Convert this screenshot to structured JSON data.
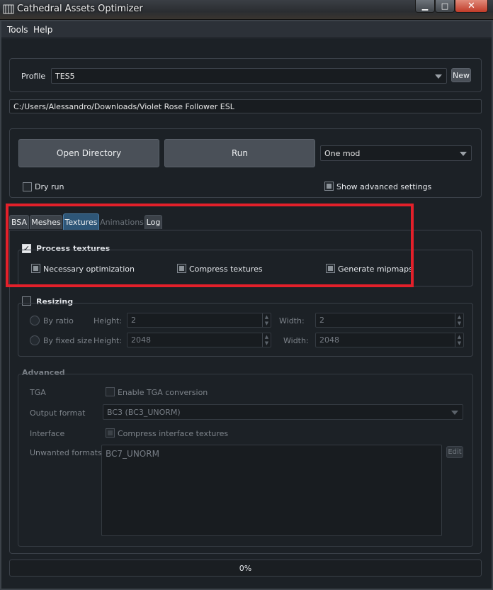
{
  "window": {
    "title": "Cathedral Assets Optimizer",
    "close_label": "✕",
    "minimize_label": "▁",
    "maximize_label": "□"
  },
  "menu": {
    "tools": "Tools",
    "help": "Help"
  },
  "profile": {
    "label": "Profile",
    "value": "TES5",
    "new_label": "New"
  },
  "path": {
    "value": "C:/Users/Alessandro/Downloads/Violet Rose Follower ESL"
  },
  "actions": {
    "open_directory": "Open Directory",
    "run": "Run",
    "mode": "One mod",
    "dry_run": "Dry run",
    "dry_run_checked": false,
    "show_advanced": "Show advanced settings",
    "show_advanced_checked": true
  },
  "tabs": [
    {
      "label": "BSA",
      "active": false,
      "enabled": true
    },
    {
      "label": "Meshes",
      "active": false,
      "enabled": true
    },
    {
      "label": "Textures",
      "active": true,
      "enabled": true
    },
    {
      "label": "Animations",
      "active": false,
      "enabled": false
    },
    {
      "label": "Log",
      "active": false,
      "enabled": true
    }
  ],
  "process_textures": {
    "label": "Process textures",
    "checked": true,
    "checkmark": "✓",
    "necessary_optimization": "Necessary optimization",
    "compress_textures": "Compress textures",
    "generate_mipmaps": "Generate mipmaps"
  },
  "resizing": {
    "label": "Resizing",
    "checked": false,
    "by_ratio": "By ratio",
    "by_fixed_size": "By fixed size",
    "height_label": "Height:",
    "width_label": "Width:",
    "ratio_height": "2",
    "ratio_width": "2",
    "fixed_height": "2048",
    "fixed_width": "2048"
  },
  "advanced": {
    "title": "Advanced",
    "tga_label": "TGA",
    "tga_option": "Enable TGA conversion",
    "output_format_label": "Output format",
    "output_format_value": "BC3 (BC3_UNORM)",
    "interface_label": "Interface",
    "interface_option": "Compress interface textures",
    "unwanted_formats_label": "Unwanted formats",
    "unwanted_formats": [
      "BC7_UNORM"
    ],
    "edit_label": "Edit"
  },
  "progress": {
    "text": "0%",
    "value": 0
  },
  "colors": {
    "highlight": "#e3202a",
    "background": "#1c2126"
  }
}
